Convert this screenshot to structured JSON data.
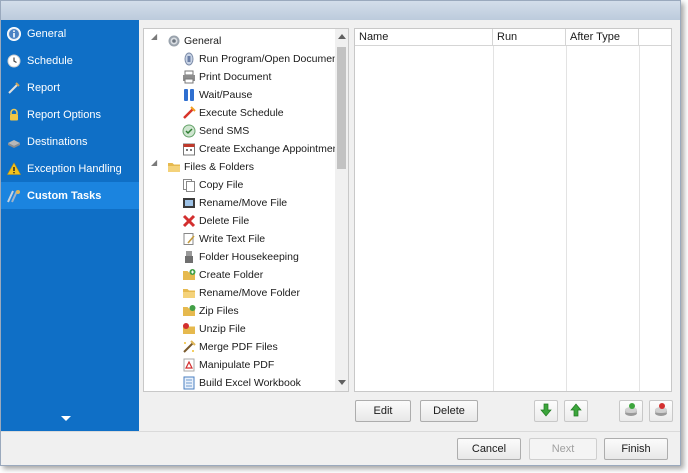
{
  "sidebar": {
    "items": [
      {
        "label": "General",
        "icon": "info-icon"
      },
      {
        "label": "Schedule",
        "icon": "clock-icon"
      },
      {
        "label": "Report",
        "icon": "report-icon"
      },
      {
        "label": "Report Options",
        "icon": "lock-icon"
      },
      {
        "label": "Destinations",
        "icon": "destinations-icon"
      },
      {
        "label": "Exception Handling",
        "icon": "warning-icon"
      },
      {
        "label": "Custom Tasks",
        "icon": "custom-tasks-icon"
      }
    ],
    "active": "Custom Tasks"
  },
  "tree": {
    "groups": [
      {
        "label": "General",
        "icon": "gear-icon",
        "items": [
          {
            "label": "Run Program/Open Document",
            "icon": "run-program-icon"
          },
          {
            "label": "Print Document",
            "icon": "printer-icon"
          },
          {
            "label": "Wait/Pause",
            "icon": "pause-icon"
          },
          {
            "label": "Execute Schedule",
            "icon": "execute-schedule-icon"
          },
          {
            "label": "Send SMS",
            "icon": "sms-icon"
          },
          {
            "label": "Create Exchange Appointment",
            "icon": "appointment-icon"
          }
        ]
      },
      {
        "label": "Files & Folders",
        "icon": "folder-icon",
        "items": [
          {
            "label": "Copy File",
            "icon": "copy-file-icon"
          },
          {
            "label": "Rename/Move File",
            "icon": "rename-file-icon"
          },
          {
            "label": "Delete File",
            "icon": "delete-icon"
          },
          {
            "label": "Write Text File",
            "icon": "write-text-icon"
          },
          {
            "label": "Folder Housekeeping",
            "icon": "housekeeping-icon"
          },
          {
            "label": "Create Folder",
            "icon": "create-folder-icon"
          },
          {
            "label": "Rename/Move Folder",
            "icon": "rename-folder-icon"
          },
          {
            "label": "Zip Files",
            "icon": "zip-icon"
          },
          {
            "label": "Unzip File",
            "icon": "unzip-icon"
          },
          {
            "label": "Merge PDF Files",
            "icon": "merge-pdf-icon"
          },
          {
            "label": "Manipulate PDF",
            "icon": "pdf-icon"
          },
          {
            "label": "Build Excel Workbook",
            "icon": "excel-icon"
          }
        ]
      }
    ]
  },
  "grid": {
    "columns": [
      "Name",
      "Run",
      "After Type"
    ],
    "rows": []
  },
  "actions": {
    "edit": "Edit",
    "delete": "Delete"
  },
  "footer": {
    "cancel": "Cancel",
    "next": "Next",
    "finish": "Finish"
  },
  "colors": {
    "sidebar_bg": "#0f6fc6",
    "sidebar_active": "#1b84df"
  }
}
